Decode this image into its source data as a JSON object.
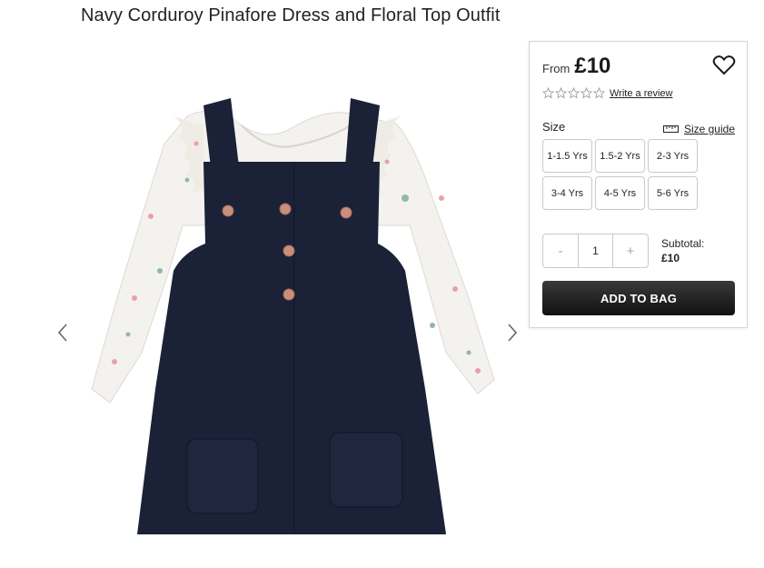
{
  "product": {
    "title": "Navy Corduroy Pinafore Dress and Floral Top Outfit",
    "image_alt": "product-image"
  },
  "gallery": {
    "prev_icon": "chevron-left-icon",
    "next_icon": "chevron-right-icon"
  },
  "pricing": {
    "from_label": "From",
    "price": "£10"
  },
  "wishlist": {
    "icon": "heart-icon"
  },
  "reviews": {
    "rating": 0,
    "max": 5,
    "link_label": "Write a review"
  },
  "size": {
    "label": "Size",
    "guide_label": "Size guide",
    "options": [
      "1-1.5 Yrs",
      "1.5-2 Yrs",
      "2-3 Yrs",
      "3-4 Yrs",
      "4-5 Yrs",
      "5-6 Yrs"
    ]
  },
  "quantity": {
    "minus": "-",
    "value": "1",
    "plus": "+"
  },
  "subtotal": {
    "label": "Subtotal:",
    "value": "£10"
  },
  "cart": {
    "add_label": "ADD TO BAG"
  },
  "colors": {
    "dress": "#1b2137",
    "top": "#f4f2ee",
    "button_dark": "#1a1a1a",
    "border": "#c9c9c9"
  }
}
